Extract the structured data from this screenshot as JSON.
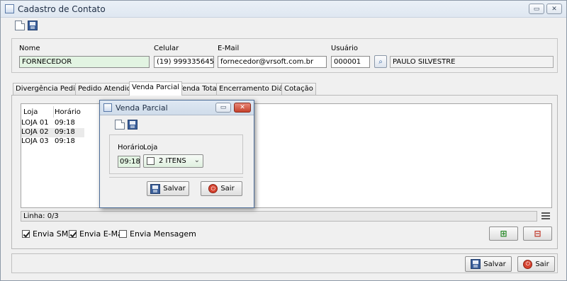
{
  "window": {
    "title": "Cadastro de Contato"
  },
  "toolbar": {
    "new_icon": "new-document-icon",
    "save_icon": "save-icon"
  },
  "form": {
    "nome_label": "Nome",
    "nome_value": "FORNECEDOR",
    "celular_label": "Celular",
    "celular_value": "(19) 999335645",
    "email_label": "E-Mail",
    "email_value": "fornecedor@vrsoft.com.br",
    "usuario_label": "Usuário",
    "usuario_code": "000001",
    "usuario_name": "PAULO SILVESTRE"
  },
  "tabs": [
    {
      "label": "Divergência Pedido"
    },
    {
      "label": "Pedido Atendido"
    },
    {
      "label": "Venda Parcial"
    },
    {
      "label": "Venda Total"
    },
    {
      "label": "Encerramento Diário"
    },
    {
      "label": "Cotação"
    }
  ],
  "active_tab": "Venda Parcial",
  "grid": {
    "headers": [
      "Loja",
      "Horário"
    ],
    "rows": [
      {
        "loja": "LOJA 01",
        "horario": "09:18"
      },
      {
        "loja": "LOJA 02",
        "horario": "09:18"
      },
      {
        "loja": "LOJA 03",
        "horario": "09:18"
      }
    ]
  },
  "status": {
    "linha": "Linha: 0/3"
  },
  "checkboxes": [
    {
      "label": "Envia SMS",
      "checked": true
    },
    {
      "label": "Envia E-Mail",
      "checked": true
    },
    {
      "label": "Envia Mensagem",
      "checked": false
    }
  ],
  "dialog": {
    "title": "Venda Parcial",
    "horario_label": "Horário",
    "horario_value": "09:18",
    "loja_label": "Loja",
    "loja_value": "2 ITENS",
    "salvar_label": "Salvar",
    "sair_label": "Sair"
  },
  "footer": {
    "salvar_label": "Salvar",
    "sair_label": "Sair"
  },
  "colors": {
    "field_green": "#e2f4e2",
    "titlebar": "#dfe7f1",
    "danger": "#d6422f"
  }
}
